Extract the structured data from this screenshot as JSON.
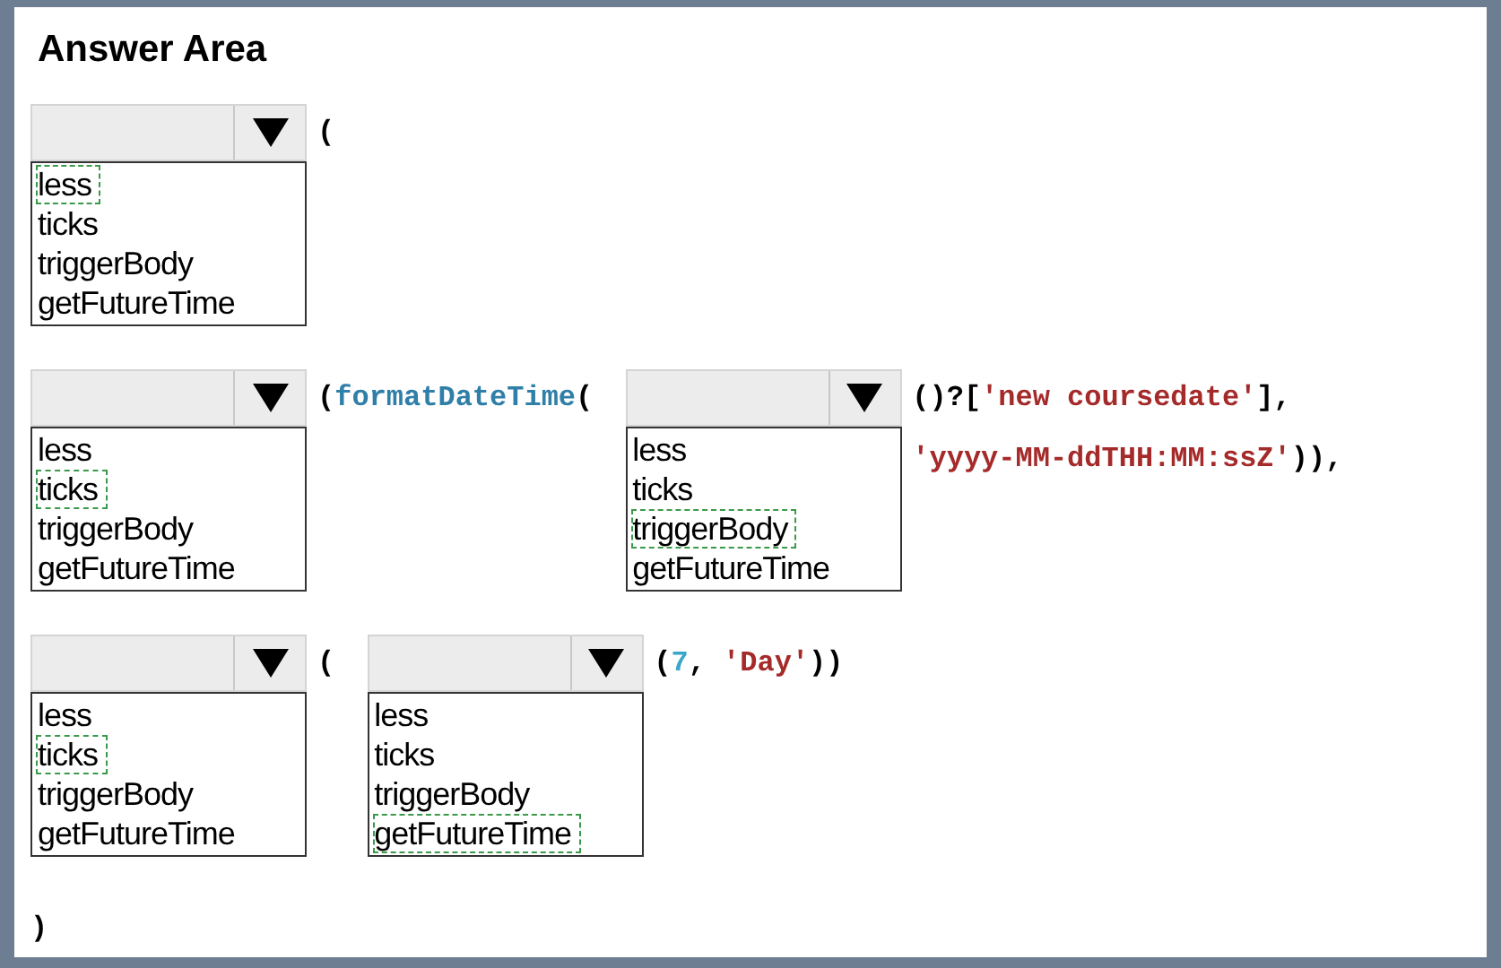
{
  "title": "Answer Area",
  "rows": [
    {
      "items": [
        {
          "kind": "dropdown",
          "options": [
            {
              "label": "less",
              "selected": true
            },
            {
              "label": "ticks",
              "selected": false
            },
            {
              "label": "triggerBody",
              "selected": false
            },
            {
              "label": "getFutureTime",
              "selected": false
            }
          ]
        },
        {
          "kind": "code",
          "lines": [
            [
              {
                "kind": "plain",
                "text": "("
              }
            ]
          ]
        }
      ]
    },
    {
      "items": [
        {
          "kind": "dropdown",
          "options": [
            {
              "label": "less",
              "selected": false
            },
            {
              "label": "ticks",
              "selected": true
            },
            {
              "label": "triggerBody",
              "selected": false
            },
            {
              "label": "getFutureTime",
              "selected": false
            }
          ]
        },
        {
          "kind": "code",
          "lines": [
            [
              {
                "kind": "plain",
                "text": "("
              },
              {
                "kind": "function",
                "text": "formatDateTime"
              },
              {
                "kind": "plain",
                "text": "("
              }
            ]
          ]
        },
        {
          "kind": "dropdown",
          "options": [
            {
              "label": "less",
              "selected": false
            },
            {
              "label": "ticks",
              "selected": false
            },
            {
              "label": "triggerBody",
              "selected": true
            },
            {
              "label": "getFutureTime",
              "selected": false
            }
          ]
        },
        {
          "kind": "code",
          "lines": [
            [
              {
                "kind": "plain",
                "text": "()?["
              },
              {
                "kind": "string",
                "text": "'new coursedate'"
              },
              {
                "kind": "plain",
                "text": "],"
              }
            ],
            [
              {
                "kind": "string",
                "text": "'yyyy-MM-ddTHH:MM:ssZ'"
              },
              {
                "kind": "plain",
                "text": ")),"
              }
            ]
          ]
        }
      ]
    },
    {
      "items": [
        {
          "kind": "dropdown",
          "options": [
            {
              "label": "less",
              "selected": false
            },
            {
              "label": "ticks",
              "selected": true
            },
            {
              "label": "triggerBody",
              "selected": false
            },
            {
              "label": "getFutureTime",
              "selected": false
            }
          ]
        },
        {
          "kind": "code",
          "lines": [
            [
              {
                "kind": "plain",
                "text": "("
              }
            ]
          ]
        },
        {
          "kind": "dropdown",
          "options": [
            {
              "label": "less",
              "selected": false
            },
            {
              "label": "ticks",
              "selected": false
            },
            {
              "label": "triggerBody",
              "selected": false
            },
            {
              "label": "getFutureTime",
              "selected": true
            }
          ]
        },
        {
          "kind": "code",
          "lines": [
            [
              {
                "kind": "plain",
                "text": "("
              },
              {
                "kind": "number",
                "text": "7"
              },
              {
                "kind": "plain",
                "text": ", "
              },
              {
                "kind": "string",
                "text": "'Day'"
              },
              {
                "kind": "plain",
                "text": "))"
              }
            ]
          ]
        }
      ]
    },
    {
      "items": [
        {
          "kind": "code",
          "lines": [
            [
              {
                "kind": "plain",
                "text": ")"
              }
            ]
          ]
        }
      ]
    }
  ]
}
